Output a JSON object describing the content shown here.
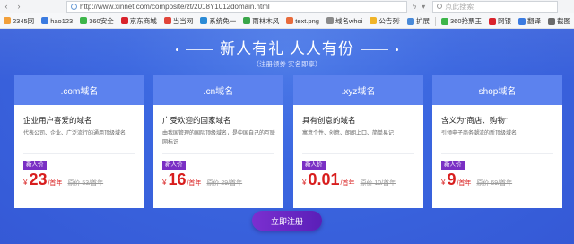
{
  "browser": {
    "url": "http://www.xinnet.com/composite/zt/2018Y1012domain.html",
    "search_placeholder": "点此搜索"
  },
  "bookmarks": {
    "items": [
      {
        "label": "2345网",
        "color": "#f2a03a"
      },
      {
        "label": "hao123",
        "color": "#3b7be0"
      },
      {
        "label": "360安全",
        "color": "#3db54a"
      },
      {
        "label": "京东商城",
        "color": "#d9232d"
      },
      {
        "label": "当当网",
        "color": "#e0453a"
      },
      {
        "label": "系统免一",
        "color": "#2b8bd6"
      },
      {
        "label": "雨林木风",
        "color": "#3aa64a"
      },
      {
        "label": "text.png",
        "color": "#e86b3b"
      },
      {
        "label": "域名whoi",
        "color": "#8a8a8a"
      },
      {
        "label": "公告列表",
        "color": "#f0b429"
      }
    ],
    "right": [
      {
        "label": "扩展",
        "color": "#4a8ad8"
      },
      {
        "label": "360抢票王",
        "color": "#3db54a"
      },
      {
        "label": "网银",
        "color": "#d9232d"
      },
      {
        "label": "翻译",
        "color": "#3b7be0"
      },
      {
        "label": "截图",
        "color": "#6a6a6a"
      }
    ]
  },
  "banner": {
    "headline": "新人有礼 人人有份",
    "subline": "（注册领券 实名即享）",
    "register_label": "立即注册"
  },
  "cards": [
    {
      "domain": ".com域名",
      "title": "企业用户喜爱的域名",
      "desc": "代表公司、企业、广泛流行的通用顶级域名",
      "tag": "新人价",
      "currency": "¥",
      "price": "23",
      "unit": "/首年",
      "original": "原价 53/首年"
    },
    {
      "domain": ".cn域名",
      "title": "广受欢迎的国家域名",
      "desc": "由我国管理的国际顶级域名，是中国自己的互联网标识",
      "tag": "新人价",
      "currency": "¥",
      "price": "16",
      "unit": "/首年",
      "original": "原价 29/首年"
    },
    {
      "domain": ".xyz域名",
      "title": "具有创意的域名",
      "desc": "寓意个性、创意、朗朗上口、简单易记",
      "tag": "新人价",
      "currency": "¥",
      "price": "0.01",
      "unit": "/首年",
      "original": "原价 10/首年"
    },
    {
      "domain": "shop域名",
      "title": "含义为“商店、购物”",
      "desc": "引领电子商务潮流的新顶级域名",
      "tag": "新人价",
      "currency": "¥",
      "price": "9",
      "unit": "/首年",
      "original": "原价 69/首年"
    }
  ]
}
